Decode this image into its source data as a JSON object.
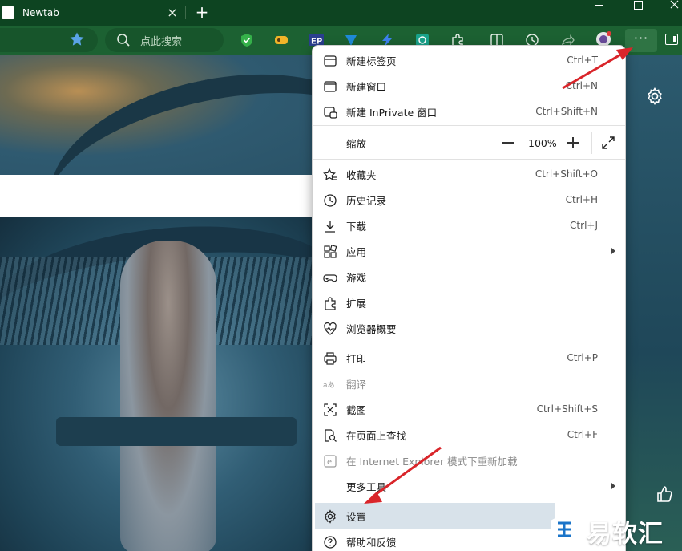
{
  "tab": {
    "title": "Newtab",
    "close_glyph": "×",
    "new_tab_glyph": "+"
  },
  "toolbar": {
    "search_label": "点此搜索",
    "more_glyph": "···",
    "accent_color": "#1c6132",
    "icons": [
      "star-icon",
      "search-icon",
      "shield-extension-icon",
      "extension-icon",
      "ep-extension-icon",
      "extension-icon",
      "lightning-extension-icon",
      "extension-icon",
      "puzzle-icon",
      "split-screen-icon",
      "history-icon",
      "share-icon",
      "profile-icon",
      "more-icon",
      "sidebar-icon"
    ]
  },
  "menu": {
    "items": [
      {
        "label": "新建标签页",
        "shortcut": "Ctrl+T",
        "icon": "new-tab-icon"
      },
      {
        "label": "新建窗口",
        "shortcut": "Ctrl+N",
        "icon": "new-window-icon"
      },
      {
        "label": "新建 InPrivate 窗口",
        "shortcut": "Ctrl+Shift+N",
        "icon": "inprivate-icon"
      },
      {
        "label": "缩放",
        "zoom_value": "100%"
      },
      {
        "label": "收藏夹",
        "shortcut": "Ctrl+Shift+O",
        "icon": "favorites-icon"
      },
      {
        "label": "历史记录",
        "shortcut": "Ctrl+H",
        "icon": "history-icon"
      },
      {
        "label": "下载",
        "shortcut": "Ctrl+J",
        "icon": "download-icon"
      },
      {
        "label": "应用",
        "icon": "apps-icon"
      },
      {
        "label": "游戏",
        "icon": "games-icon"
      },
      {
        "label": "扩展",
        "icon": "extensions-icon"
      },
      {
        "label": "浏览器概要",
        "icon": "browser-essentials-icon"
      },
      {
        "label": "打印",
        "shortcut": "Ctrl+P",
        "icon": "print-icon"
      },
      {
        "label": "翻译",
        "icon": "translate-icon"
      },
      {
        "label": "截图",
        "shortcut": "Ctrl+Shift+S",
        "icon": "screenshot-icon"
      },
      {
        "label": "在页面上查找",
        "shortcut": "Ctrl+F",
        "icon": "find-icon"
      },
      {
        "label": "在 Internet Explorer 模式下重新加载",
        "icon": "ie-mode-icon"
      },
      {
        "label": "更多工具",
        "icon": "more-tools-icon"
      },
      {
        "label": "设置",
        "icon": "settings-icon"
      },
      {
        "label": "帮助和反馈",
        "icon": "help-icon"
      }
    ]
  },
  "annotation_color": "#d9252a",
  "watermark": {
    "text": "易软汇"
  }
}
